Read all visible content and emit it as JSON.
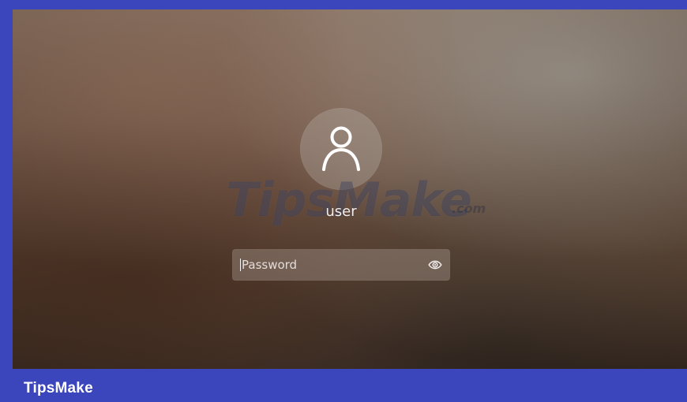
{
  "lock_screen": {
    "username": "user",
    "password_placeholder": "Password",
    "icons": {
      "avatar": "user-avatar-icon",
      "reveal": "eye-icon"
    }
  },
  "branding": {
    "watermark_main": "TipsMake",
    "watermark_suffix": ".com",
    "footer_label": "TipsMake"
  },
  "colors": {
    "frame": "#3b46bd",
    "text": "#ffffff"
  }
}
